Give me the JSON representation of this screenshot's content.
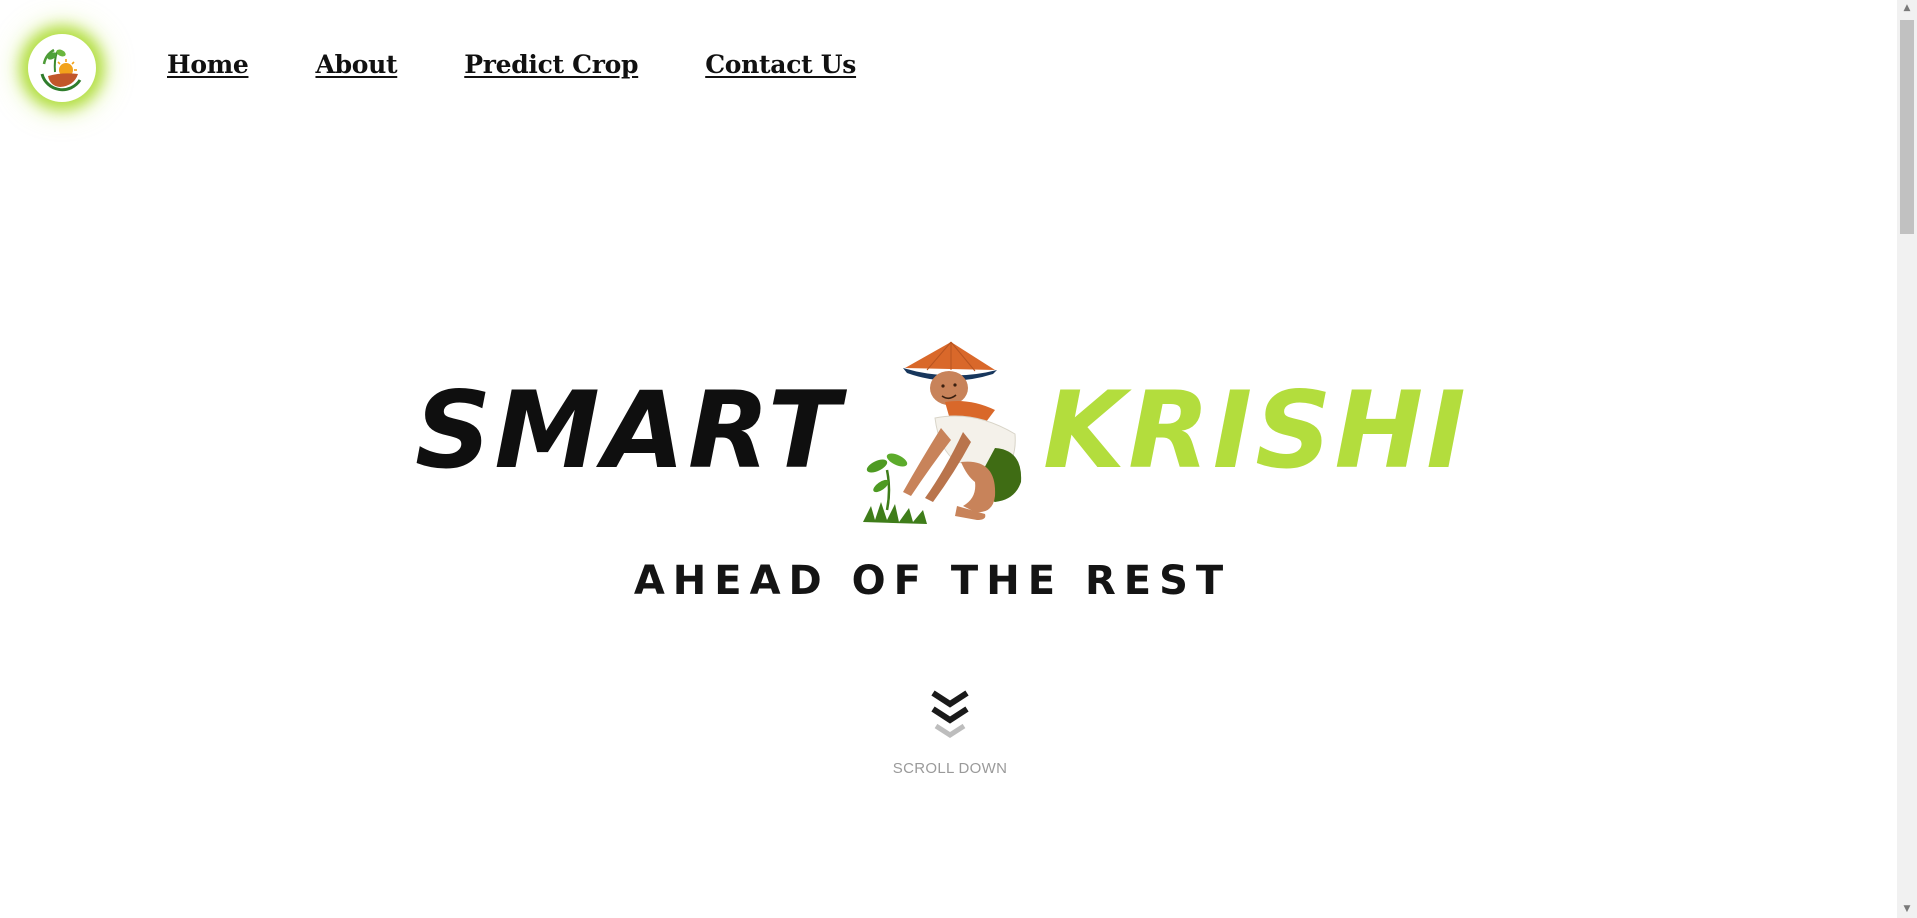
{
  "header": {
    "nav": [
      {
        "label": "Home"
      },
      {
        "label": "About"
      },
      {
        "label": "Predict Crop"
      },
      {
        "label": "Contact Us"
      }
    ]
  },
  "hero": {
    "brand_part1": "SMART",
    "brand_part2": "KRISHI",
    "tagline": "AHEAD OF THE REST",
    "colors": {
      "brand_dark": "#0f0f0f",
      "brand_green": "#b3dd3d",
      "glow": "#a0d618"
    }
  },
  "scroll_cue": {
    "label": "SCROLL DOWN",
    "icon": "chevron-double-down-icon"
  },
  "scrollbar": {
    "up_icon": "▲",
    "down_icon": "▼"
  }
}
